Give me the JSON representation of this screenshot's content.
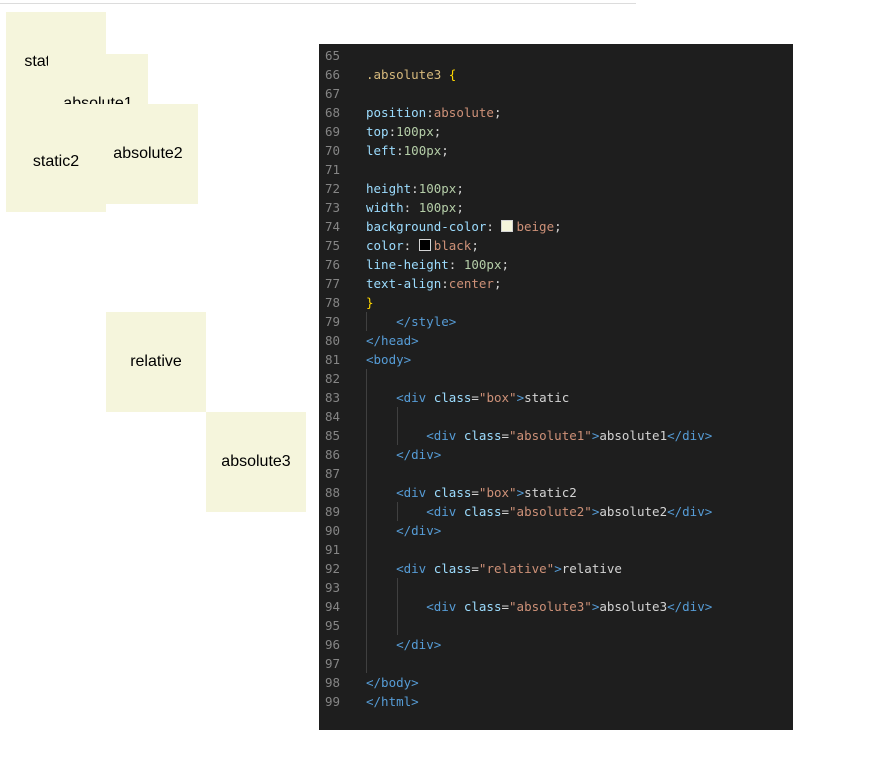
{
  "preview": {
    "static_label": "static",
    "absolute1_label": "absolute1",
    "static2_label": "static2",
    "absolute2_label": "absolute2",
    "relative_label": "relative",
    "absolute3_label": "absolute3"
  },
  "colors": {
    "editor_bg": "#1e1e1e",
    "beige": "#f5f5dc",
    "black": "#000000"
  },
  "editor": {
    "lines": [
      {
        "n": "65",
        "segs": []
      },
      {
        "n": "66",
        "segs": [
          [
            "selector",
            ".absolute3"
          ],
          [
            "punc",
            " "
          ],
          [
            "brace",
            "{"
          ]
        ]
      },
      {
        "n": "67",
        "segs": []
      },
      {
        "n": "68",
        "segs": [
          [
            "prop",
            "position"
          ],
          [
            "punc",
            ":"
          ],
          [
            "kw",
            "absolute"
          ],
          [
            "punc",
            ";"
          ]
        ]
      },
      {
        "n": "69",
        "segs": [
          [
            "prop",
            "top"
          ],
          [
            "punc",
            ":"
          ],
          [
            "num",
            "100px"
          ],
          [
            "punc",
            ";"
          ]
        ]
      },
      {
        "n": "70",
        "segs": [
          [
            "prop",
            "left"
          ],
          [
            "punc",
            ":"
          ],
          [
            "num",
            "100px"
          ],
          [
            "punc",
            ";"
          ]
        ]
      },
      {
        "n": "71",
        "segs": []
      },
      {
        "n": "72",
        "segs": [
          [
            "prop",
            "height"
          ],
          [
            "punc",
            ":"
          ],
          [
            "num",
            "100px"
          ],
          [
            "punc",
            ";"
          ]
        ]
      },
      {
        "n": "73",
        "segs": [
          [
            "prop",
            "width"
          ],
          [
            "punc",
            ": "
          ],
          [
            "num",
            "100px"
          ],
          [
            "punc",
            ";"
          ]
        ]
      },
      {
        "n": "74",
        "segs": [
          [
            "prop",
            "background-color"
          ],
          [
            "punc",
            ": "
          ],
          [
            "swatch",
            "#f5f5dc"
          ],
          [
            "kw",
            "beige"
          ],
          [
            "punc",
            ";"
          ]
        ]
      },
      {
        "n": "75",
        "segs": [
          [
            "prop",
            "color"
          ],
          [
            "punc",
            ": "
          ],
          [
            "swatch",
            "#000000"
          ],
          [
            "kw",
            "black"
          ],
          [
            "punc",
            ";"
          ]
        ]
      },
      {
        "n": "76",
        "segs": [
          [
            "prop",
            "line-height"
          ],
          [
            "punc",
            ": "
          ],
          [
            "num",
            "100px"
          ],
          [
            "punc",
            ";"
          ]
        ]
      },
      {
        "n": "77",
        "segs": [
          [
            "prop",
            "text-align"
          ],
          [
            "punc",
            ":"
          ],
          [
            "kw",
            "center"
          ],
          [
            "punc",
            ";"
          ]
        ]
      },
      {
        "n": "78",
        "segs": [
          [
            "brace",
            "}"
          ]
        ]
      },
      {
        "n": "79",
        "segs": [
          [
            "txt",
            "    "
          ],
          [
            "tag",
            "</style>"
          ]
        ],
        "guides": [
          1
        ]
      },
      {
        "n": "80",
        "segs": [
          [
            "tag",
            "</head>"
          ]
        ]
      },
      {
        "n": "81",
        "segs": [
          [
            "tag",
            "<body>"
          ]
        ]
      },
      {
        "n": "82",
        "segs": [],
        "guides": [
          1
        ]
      },
      {
        "n": "83",
        "segs": [
          [
            "txt",
            "    "
          ],
          [
            "tag",
            "<div "
          ],
          [
            "attr",
            "class"
          ],
          [
            "punc",
            "="
          ],
          [
            "str",
            "\"box\""
          ],
          [
            "tag",
            ">"
          ],
          [
            "txt",
            "static"
          ]
        ],
        "guides": [
          1
        ]
      },
      {
        "n": "84",
        "segs": [],
        "guides": [
          1,
          2
        ]
      },
      {
        "n": "85",
        "segs": [
          [
            "txt",
            "        "
          ],
          [
            "tag",
            "<div "
          ],
          [
            "attr",
            "class"
          ],
          [
            "punc",
            "="
          ],
          [
            "str",
            "\"absolute1\""
          ],
          [
            "tag",
            ">"
          ],
          [
            "txt",
            "absolute1"
          ],
          [
            "tag",
            "</div>"
          ]
        ],
        "guides": [
          1,
          2
        ]
      },
      {
        "n": "86",
        "segs": [
          [
            "txt",
            "    "
          ],
          [
            "tag",
            "</div>"
          ]
        ],
        "guides": [
          1
        ]
      },
      {
        "n": "87",
        "segs": [],
        "guides": [
          1
        ]
      },
      {
        "n": "88",
        "segs": [
          [
            "txt",
            "    "
          ],
          [
            "tag",
            "<div "
          ],
          [
            "attr",
            "class"
          ],
          [
            "punc",
            "="
          ],
          [
            "str",
            "\"box\""
          ],
          [
            "tag",
            ">"
          ],
          [
            "txt",
            "static2"
          ]
        ],
        "guides": [
          1
        ]
      },
      {
        "n": "89",
        "segs": [
          [
            "txt",
            "        "
          ],
          [
            "tag",
            "<div "
          ],
          [
            "attr",
            "class"
          ],
          [
            "punc",
            "="
          ],
          [
            "str",
            "\"absolute2\""
          ],
          [
            "tag",
            ">"
          ],
          [
            "txt",
            "absolute2"
          ],
          [
            "tag",
            "</div>"
          ]
        ],
        "guides": [
          1,
          2
        ]
      },
      {
        "n": "90",
        "segs": [
          [
            "txt",
            "    "
          ],
          [
            "tag",
            "</div>"
          ]
        ],
        "guides": [
          1
        ]
      },
      {
        "n": "91",
        "segs": [],
        "guides": [
          1
        ]
      },
      {
        "n": "92",
        "segs": [
          [
            "txt",
            "    "
          ],
          [
            "tag",
            "<div "
          ],
          [
            "attr",
            "class"
          ],
          [
            "punc",
            "="
          ],
          [
            "str",
            "\"relative\""
          ],
          [
            "tag",
            ">"
          ],
          [
            "txt",
            "relative"
          ]
        ],
        "guides": [
          1
        ]
      },
      {
        "n": "93",
        "segs": [],
        "guides": [
          1,
          2
        ]
      },
      {
        "n": "94",
        "segs": [
          [
            "txt",
            "        "
          ],
          [
            "tag",
            "<div "
          ],
          [
            "attr",
            "class"
          ],
          [
            "punc",
            "="
          ],
          [
            "str",
            "\"absolute3\""
          ],
          [
            "tag",
            ">"
          ],
          [
            "txt",
            "absolute3"
          ],
          [
            "tag",
            "</div>"
          ]
        ],
        "guides": [
          1,
          2
        ]
      },
      {
        "n": "95",
        "segs": [],
        "guides": [
          1,
          2
        ]
      },
      {
        "n": "96",
        "segs": [
          [
            "txt",
            "    "
          ],
          [
            "tag",
            "</div>"
          ]
        ],
        "guides": [
          1
        ]
      },
      {
        "n": "97",
        "segs": [],
        "guides": [
          1
        ]
      },
      {
        "n": "98",
        "segs": [
          [
            "tag",
            "</body>"
          ]
        ]
      },
      {
        "n": "99",
        "segs": [
          [
            "tag",
            "</html>"
          ]
        ]
      }
    ]
  }
}
